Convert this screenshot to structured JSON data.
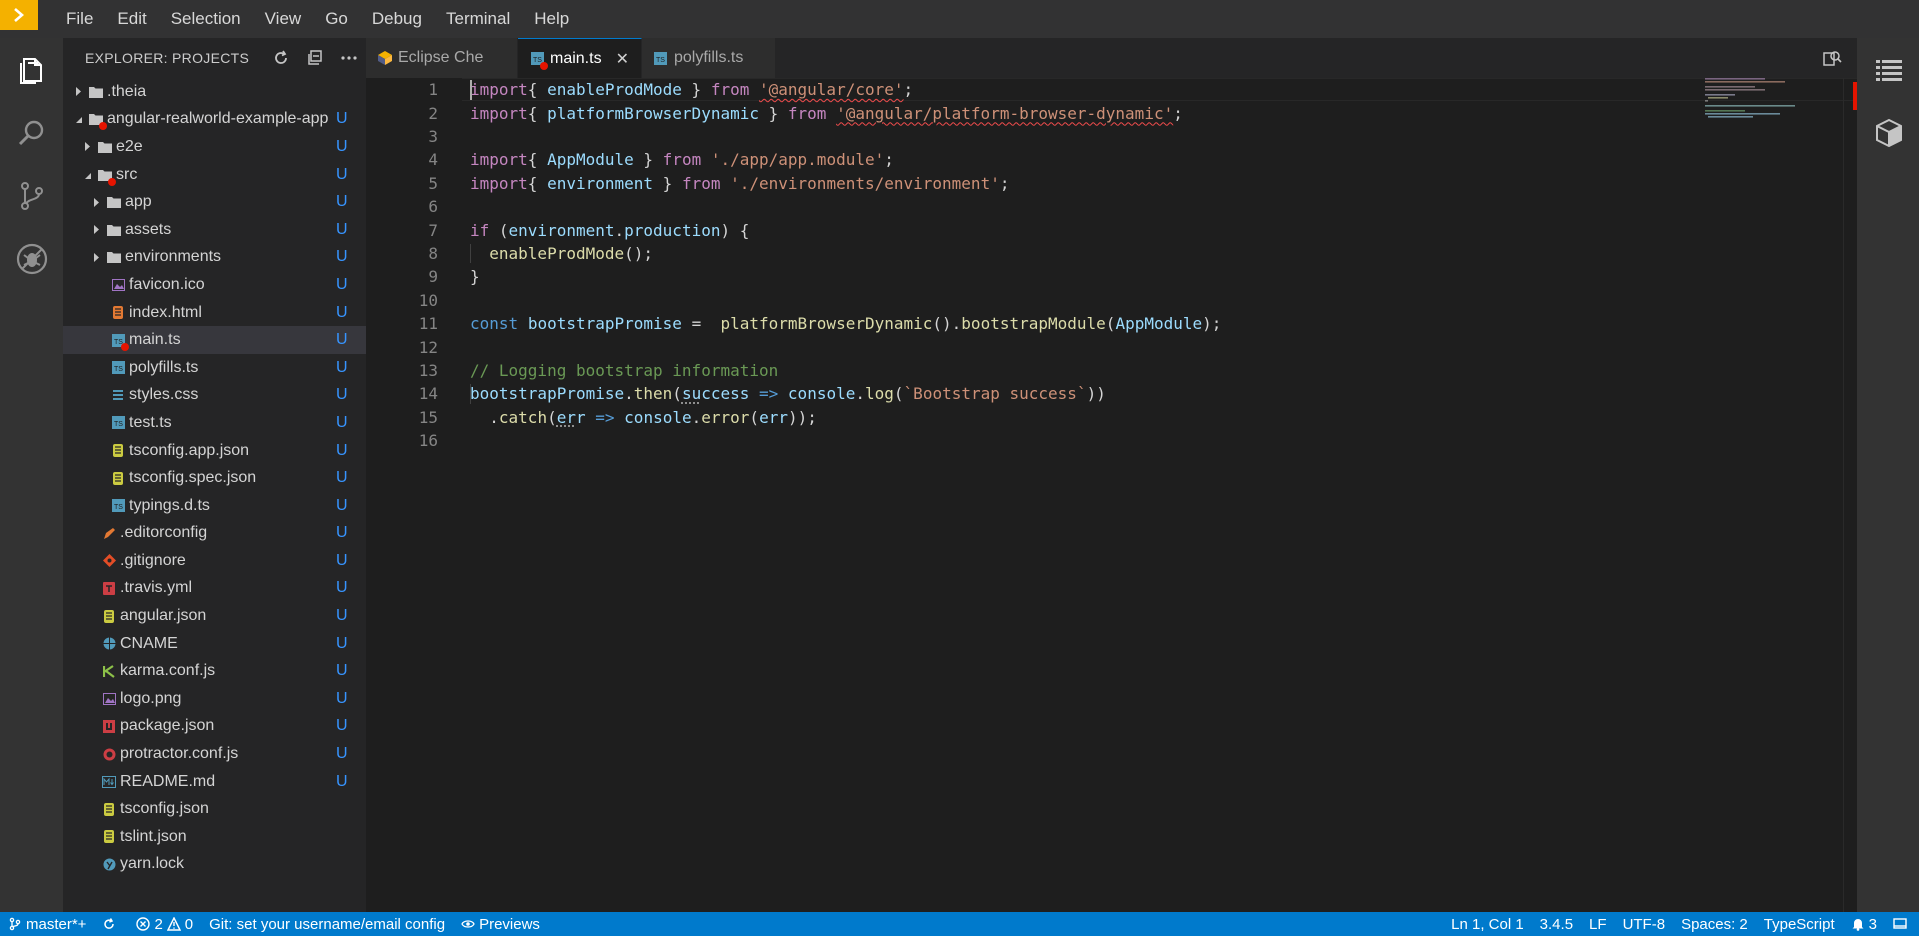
{
  "menubar": {
    "items": [
      "File",
      "Edit",
      "Selection",
      "View",
      "Go",
      "Debug",
      "Terminal",
      "Help"
    ]
  },
  "activitybar": {
    "icons": [
      "explorer-icon",
      "search-icon",
      "source-control-icon",
      "debug-icon"
    ]
  },
  "sidebar": {
    "title": "EXPLORER: PROJECTS",
    "tree": [
      {
        "name": ".theia",
        "type": "folder",
        "depth": 0,
        "expanded": false,
        "badge": "",
        "icon": "folder-icon"
      },
      {
        "name": "angular-realworld-example-app",
        "type": "folder",
        "depth": 0,
        "expanded": true,
        "badge": "U",
        "icon": "folder-icon",
        "error": true
      },
      {
        "name": "e2e",
        "type": "folder",
        "depth": 1,
        "expanded": false,
        "badge": "U",
        "icon": "folder-icon"
      },
      {
        "name": "src",
        "type": "folder",
        "depth": 1,
        "expanded": true,
        "badge": "U",
        "icon": "folder-icon",
        "error": true
      },
      {
        "name": "app",
        "type": "folder",
        "depth": 2,
        "expanded": false,
        "badge": "U",
        "icon": "folder-icon"
      },
      {
        "name": "assets",
        "type": "folder",
        "depth": 2,
        "expanded": false,
        "badge": "U",
        "icon": "folder-icon"
      },
      {
        "name": "environments",
        "type": "folder",
        "depth": 2,
        "expanded": false,
        "badge": "U",
        "icon": "folder-icon"
      },
      {
        "name": "favicon.ico",
        "type": "file",
        "depth": 2,
        "badge": "U",
        "icon": "image-file-icon"
      },
      {
        "name": "index.html",
        "type": "file",
        "depth": 2,
        "badge": "U",
        "icon": "html-file-icon"
      },
      {
        "name": "main.ts",
        "type": "file",
        "depth": 2,
        "badge": "U",
        "icon": "ts-file-icon",
        "error": true,
        "selected": true
      },
      {
        "name": "polyfills.ts",
        "type": "file",
        "depth": 2,
        "badge": "U",
        "icon": "ts-file-icon"
      },
      {
        "name": "styles.css",
        "type": "file",
        "depth": 2,
        "badge": "U",
        "icon": "css-file-icon"
      },
      {
        "name": "test.ts",
        "type": "file",
        "depth": 2,
        "badge": "U",
        "icon": "ts-file-icon"
      },
      {
        "name": "tsconfig.app.json",
        "type": "file",
        "depth": 2,
        "badge": "U",
        "icon": "json-file-icon"
      },
      {
        "name": "tsconfig.spec.json",
        "type": "file",
        "depth": 2,
        "badge": "U",
        "icon": "json-file-icon"
      },
      {
        "name": "typings.d.ts",
        "type": "file",
        "depth": 2,
        "badge": "U",
        "icon": "ts-file-icon"
      },
      {
        "name": ".editorconfig",
        "type": "file",
        "depth": 1,
        "badge": "U",
        "icon": "editorconfig-file-icon"
      },
      {
        "name": ".gitignore",
        "type": "file",
        "depth": 1,
        "badge": "U",
        "icon": "git-file-icon"
      },
      {
        "name": ".travis.yml",
        "type": "file",
        "depth": 1,
        "badge": "U",
        "icon": "travis-file-icon"
      },
      {
        "name": "angular.json",
        "type": "file",
        "depth": 1,
        "badge": "U",
        "icon": "json-file-icon"
      },
      {
        "name": "CNAME",
        "type": "file",
        "depth": 1,
        "badge": "U",
        "icon": "globe-file-icon"
      },
      {
        "name": "karma.conf.js",
        "type": "file",
        "depth": 1,
        "badge": "U",
        "icon": "karma-file-icon"
      },
      {
        "name": "logo.png",
        "type": "file",
        "depth": 1,
        "badge": "U",
        "icon": "image-file-icon"
      },
      {
        "name": "package.json",
        "type": "file",
        "depth": 1,
        "badge": "U",
        "icon": "npm-file-icon"
      },
      {
        "name": "protractor.conf.js",
        "type": "file",
        "depth": 1,
        "badge": "U",
        "icon": "protractor-file-icon"
      },
      {
        "name": "README.md",
        "type": "file",
        "depth": 1,
        "badge": "U",
        "icon": "markdown-file-icon"
      },
      {
        "name": "tsconfig.json",
        "type": "file",
        "depth": 1,
        "badge": "",
        "icon": "json-file-icon"
      },
      {
        "name": "tslint.json",
        "type": "file",
        "depth": 1,
        "badge": "",
        "icon": "json-file-icon"
      },
      {
        "name": "yarn.lock",
        "type": "file",
        "depth": 1,
        "badge": "",
        "icon": "yarn-file-icon"
      }
    ]
  },
  "tabs": [
    {
      "label": "Eclipse Che",
      "active": false,
      "icon": "che-icon"
    },
    {
      "label": "main.ts",
      "active": true,
      "icon": "ts-file-icon",
      "close": "✕"
    },
    {
      "label": "polyfills.ts",
      "active": false,
      "icon": "ts-file-icon"
    }
  ],
  "editor": {
    "lines": [
      [
        [
          "kw",
          "import"
        ],
        [
          "",
          "{ "
        ],
        [
          "id",
          "enableProdMode"
        ],
        [
          "",
          " } "
        ],
        [
          "kw",
          "from"
        ],
        [
          "",
          " "
        ],
        [
          "str squig",
          "'@angular/core'"
        ],
        [
          "",
          ";"
        ]
      ],
      [
        [
          "kw",
          "import"
        ],
        [
          "",
          "{ "
        ],
        [
          "id",
          "platformBrowserDynamic"
        ],
        [
          "",
          " } "
        ],
        [
          "kw",
          "from"
        ],
        [
          "",
          " "
        ],
        [
          "str squig",
          "'@angular/platform-browser-dynamic'"
        ],
        [
          "",
          ";"
        ]
      ],
      [],
      [
        [
          "kw",
          "import"
        ],
        [
          "",
          "{ "
        ],
        [
          "id",
          "AppModule"
        ],
        [
          "",
          " } "
        ],
        [
          "kw",
          "from"
        ],
        [
          "",
          " "
        ],
        [
          "str",
          "'./app/app.module'"
        ],
        [
          "",
          ";"
        ]
      ],
      [
        [
          "kw",
          "import"
        ],
        [
          "",
          "{ "
        ],
        [
          "id",
          "environment"
        ],
        [
          "",
          " } "
        ],
        [
          "kw",
          "from"
        ],
        [
          "",
          " "
        ],
        [
          "str",
          "'./environments/environment'"
        ],
        [
          "",
          ";"
        ]
      ],
      [],
      [
        [
          "kw",
          "if"
        ],
        [
          "",
          " ("
        ],
        [
          "id",
          "environment"
        ],
        [
          "",
          "."
        ],
        [
          "id",
          "production"
        ],
        [
          "",
          ") {"
        ]
      ],
      [
        [
          "",
          "  "
        ],
        [
          "fn",
          "enableProdMode"
        ],
        [
          "",
          "();"
        ]
      ],
      [
        [
          "",
          "}"
        ]
      ],
      [],
      [
        [
          "kw2",
          "const"
        ],
        [
          "",
          " "
        ],
        [
          "id",
          "bootstrapPromise"
        ],
        [
          "",
          " =  "
        ],
        [
          "fn",
          "platformBrowserDynamic"
        ],
        [
          "",
          "()."
        ],
        [
          "fn",
          "bootstrapModule"
        ],
        [
          "",
          "("
        ],
        [
          "id",
          "AppModule"
        ],
        [
          "",
          ");"
        ]
      ],
      [],
      [
        [
          "cm",
          "// Logging bootstrap information"
        ]
      ],
      [
        [
          "id",
          "bootstrapPromise"
        ],
        [
          "",
          "."
        ],
        [
          "fn",
          "then"
        ],
        [
          "",
          "("
        ],
        [
          "id dotted",
          "su"
        ],
        [
          "id",
          "ccess"
        ],
        [
          "",
          " "
        ],
        [
          "kw2",
          "=>"
        ],
        [
          "",
          " "
        ],
        [
          "id",
          "console"
        ],
        [
          "",
          "."
        ],
        [
          "fn",
          "log"
        ],
        [
          "",
          "("
        ],
        [
          "str",
          "`Bootstrap success`"
        ],
        [
          "",
          "))"
        ]
      ],
      [
        [
          "",
          "  ."
        ],
        [
          "fn",
          "catch"
        ],
        [
          "",
          "("
        ],
        [
          "id dotted",
          "er"
        ],
        [
          "id",
          "r"
        ],
        [
          "",
          " "
        ],
        [
          "kw2",
          "=>"
        ],
        [
          "",
          " "
        ],
        [
          "id",
          "console"
        ],
        [
          "",
          "."
        ],
        [
          "fn",
          "error"
        ],
        [
          "",
          "("
        ],
        [
          "id",
          "err"
        ],
        [
          "",
          "));"
        ]
      ],
      []
    ]
  },
  "rightbar": {
    "icons": [
      "outline-icon",
      "package-icon"
    ]
  },
  "statusbar": {
    "branch": "master*+",
    "errors": "2",
    "warnings": "0",
    "git_message": "Git: set your username/email config",
    "previews": "Previews",
    "position": "Ln 1, Col 1",
    "version": "3.4.5",
    "eol": "LF",
    "encoding": "UTF-8",
    "indent": "Spaces: 2",
    "language": "TypeScript",
    "notifications": "3"
  },
  "colors": {
    "accent": "#007acc",
    "logo": "#f4b100",
    "badge": "#3794ff",
    "error": "#e51400"
  }
}
